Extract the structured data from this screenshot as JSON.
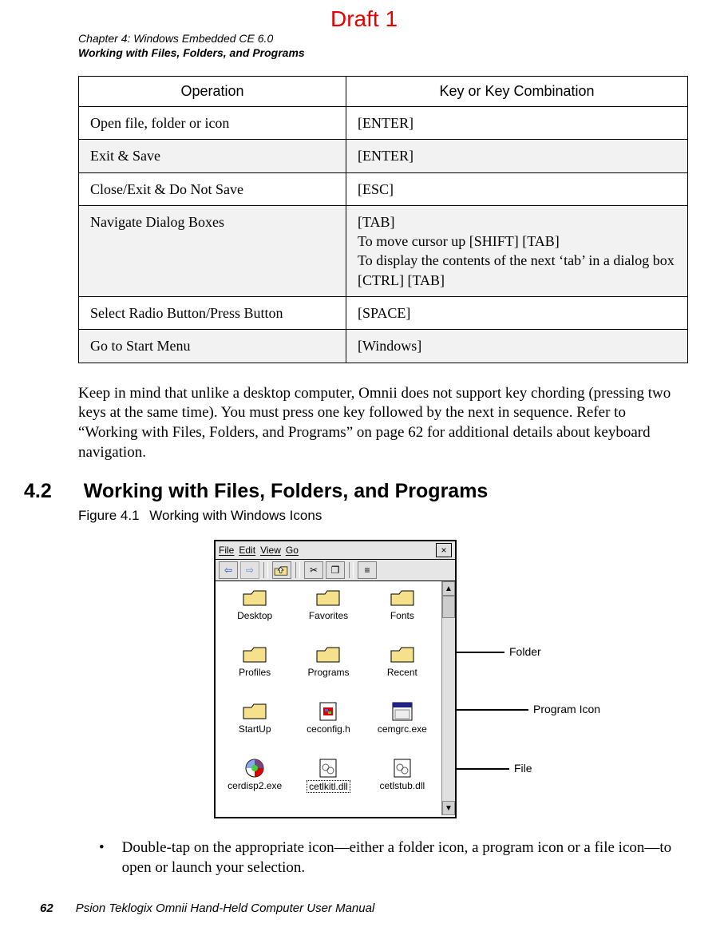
{
  "draft": "Draft 1",
  "header": {
    "chapter_line": "Chapter 4:  Windows Embedded CE 6.0",
    "section_line": "Working with Files, Folders, and Programs"
  },
  "table": {
    "headers": [
      "Operation",
      "Key or Key Combination"
    ],
    "rows": [
      {
        "op": "Open file, folder or icon",
        "key": "[ENTER]",
        "shaded": false
      },
      {
        "op": "Exit & Save",
        "key": "[ENTER]",
        "shaded": true
      },
      {
        "op": "Close/Exit & Do Not Save",
        "key": "[ESC]",
        "shaded": false
      },
      {
        "op": "Navigate Dialog Boxes",
        "key": "[TAB]\nTo move cursor up [SHIFT] [TAB]\nTo display the contents of the next ‘tab’ in a dialog box [CTRL] [TAB]",
        "shaded": true
      },
      {
        "op": "Select Radio Button/Press Button",
        "key": "[SPACE]",
        "shaded": false
      },
      {
        "op": "Go to Start Menu",
        "key": "[Windows]",
        "shaded": true
      }
    ]
  },
  "paragraph1": "Keep in mind that unlike a desktop computer, Omnii does not support key chording (pressing two keys at the same time). You must press one key followed by the next in sequence. Refer to “Working with Files, Folders, and Programs” on page 62 for additional details about keyboard navigation.",
  "section": {
    "num": "4.2",
    "title": "Working with Files, Folders, and Programs"
  },
  "figure_caption": {
    "num": "Figure 4.1",
    "text": "Working with Windows Icons"
  },
  "explorer": {
    "menus": [
      "File",
      "Edit",
      "View",
      "Go"
    ],
    "close": "×",
    "toolbar": {
      "back": "⇦",
      "forward": "⇨",
      "up": "⇧",
      "cut": "✂",
      "copy": "❐",
      "props": "≡"
    },
    "items": [
      {
        "label": "Desktop",
        "kind": "folder"
      },
      {
        "label": "Favorites",
        "kind": "folder"
      },
      {
        "label": "Fonts",
        "kind": "folder"
      },
      {
        "label": "Profiles",
        "kind": "folder"
      },
      {
        "label": "Programs",
        "kind": "folder"
      },
      {
        "label": "Recent",
        "kind": "folder"
      },
      {
        "label": "StartUp",
        "kind": "folder"
      },
      {
        "label": "ceconfig.h",
        "kind": "file-h"
      },
      {
        "label": "cemgrc.exe",
        "kind": "program"
      },
      {
        "label": "cerdisp2.exe",
        "kind": "exe"
      },
      {
        "label": "cetlkitl.dll",
        "kind": "file-dll",
        "selected": true
      },
      {
        "label": "cetlstub.dll",
        "kind": "file-dll"
      }
    ],
    "callouts": {
      "folder": "Folder",
      "program": "Program Icon",
      "file": "File"
    }
  },
  "after_figure_bullet": "Double-tap on the appropriate icon—either a folder icon, a program icon or a file icon—to open or launch your selection.",
  "footer": {
    "page": "62",
    "title": "Psion Teklogix Omnii Hand-Held Computer User Manual"
  }
}
